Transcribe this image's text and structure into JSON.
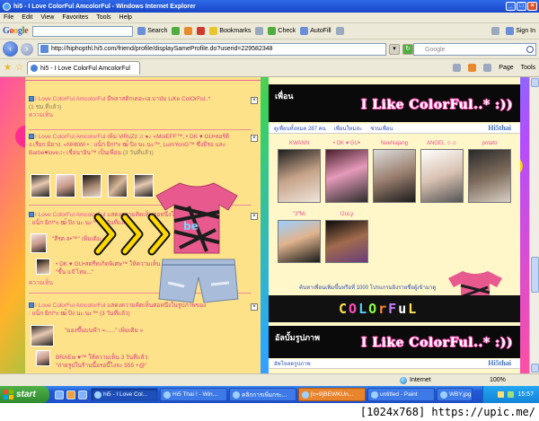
{
  "window": {
    "title": "hi5 - I Love ColorFul AmcolorFul - Windows Internet Explorer"
  },
  "menu": [
    "File",
    "Edit",
    "View",
    "Favorites",
    "Tools",
    "Help"
  ],
  "gtoolbar": {
    "logo": "Google",
    "search_label": "Search",
    "bookmarks": "Bookmarks",
    "check": "Check",
    "autofill": "AutoFill",
    "signin": "Sign In"
  },
  "address": {
    "url": "http://hiphopthl.hi5.com/friend/profile/displaySameProfile.do?userid=229582348",
    "search_placeholder": "Google"
  },
  "tabs": {
    "active": "hi5 - I Love ColorFul AmcolorFul",
    "page_label": "Page",
    "tools_label": "Tools"
  },
  "left": {
    "c1": {
      "name": "I Love ColorFul AmcolorFul",
      "text": "มีพลาสติกเดอะเอ.บาป่ม LiKe ColOrFul..*",
      "meta": "(1 ชม.ที่แล้ว)",
      "reply": "ความเห็น"
    },
    "c2": {
      "name": "I Love ColorFul AmcolorFul",
      "text": "เพิ่ม ViRuZz ♫ ●♪ «MoiEFF™, • DK ♥ GU•ลอร์ดิง.เรียก.มิยาง. «NHbWi • ",
      "text2": ": แน็ก ยิก!*ಠ ໝ์ ปิง นะ.นะ™, LumYonG™ ซึ่งมีรอ และ Barbe♥love♫‹ เชื่อนาอิน™ เป็นเพื่อน",
      "meta": "(3 วันที่แล้ว)"
    },
    "c3": {
      "name": "I Love ColorFul AmcolorFul",
      "text": "แสดงความคิดเห็นต่อหนึ่งในรูปภาพของ",
      "text2": ": แน็ก ยิก!*ಠ ໝ์ ปิง นะ.นะ™ (3 วันที่แล้ว)",
      "quote": "\"สีรด ล•™\" เพิ่มเติม »"
    },
    "c3b": {
      "line": "• DK ♥ GU•สตรีทเกิดพิเศษ™ ให้ความเห็น 3 วันที่แล้ว:",
      "quote": "\"ขี้น แจ๊ ไหม...\"",
      "reply": "ความเห็น"
    },
    "c4": {
      "name": "I Love ColorFul AmcolorFul",
      "text": "แสดงความคิดเห็นต่อหนึ่งในรูปภาพของ",
      "text2": ": แน็ก ยิก!*ಠ ໝ์ ปิง นะ.นะ™ (3 วันที่แล้ว)",
      "quote": "\"มองขึ้นบนฟ้า =-.....\" เพิ่มเติม »"
    },
    "c4b": {
      "line": "BRAEw ♥™ ให้ความเห็น 3 วันที่แล้ว:",
      "quote": "\"ถ่ายรูปในร้านนี้อรอนี้ไงจะ 555 +@\""
    }
  },
  "right": {
    "friends_label": "เพื่อน",
    "banner": "I Like ColorFul..* :))",
    "info": [
      "ดูเพื่อนทั้งหมด 287 คน",
      "เพื่อนใหม่ล่ะ",
      "ชวนเพื่อน"
    ],
    "hi5": "Hi5thai",
    "friends_row1": [
      "KWANN",
      "• DK ♥ GU•",
      "NeeNajang",
      "ANGEL ☺☺",
      "potato"
    ],
    "friends_row2": [
      "''",
      "\"3\"Mi",
      "I2uLy"
    ],
    "see_all": "ค้นหาเพื่อนเพิ่มขึ้นหรือที่ 1000 โปรแกรมอิงรายชื่อผู้เข้ามาดู",
    "colorful": [
      "C",
      "O",
      "L",
      "O",
      "r",
      "F",
      "u",
      "L"
    ],
    "colorful_colors": [
      "#ffe14a",
      "#ff4fb8",
      "#4fd3ff",
      "#8dff4a",
      "#ff8a3a",
      "#c27bff",
      "#ffffff",
      "#ffe14a"
    ],
    "photos_label": "อัลบั้มรูปภาพ",
    "photos_banner": "I Like ColorFul..* :))",
    "photos_info": "อัพโหลดรูปภาพ",
    "hi5_2": "Hi5thai"
  },
  "status": {
    "zone": "Internet",
    "zoom": "100%"
  },
  "taskbar": {
    "start": "start",
    "items": [
      "hi5 - I Love Col...",
      "Hi5 Thai ! - Win...",
      "คลิกการเพิ่มกระ...",
      "[c=9]BEWKUn...",
      "untitled - Paint",
      "WBY.jpg"
    ],
    "clock": "15:57"
  },
  "watermark": "[1024x768] https://upic.me/"
}
